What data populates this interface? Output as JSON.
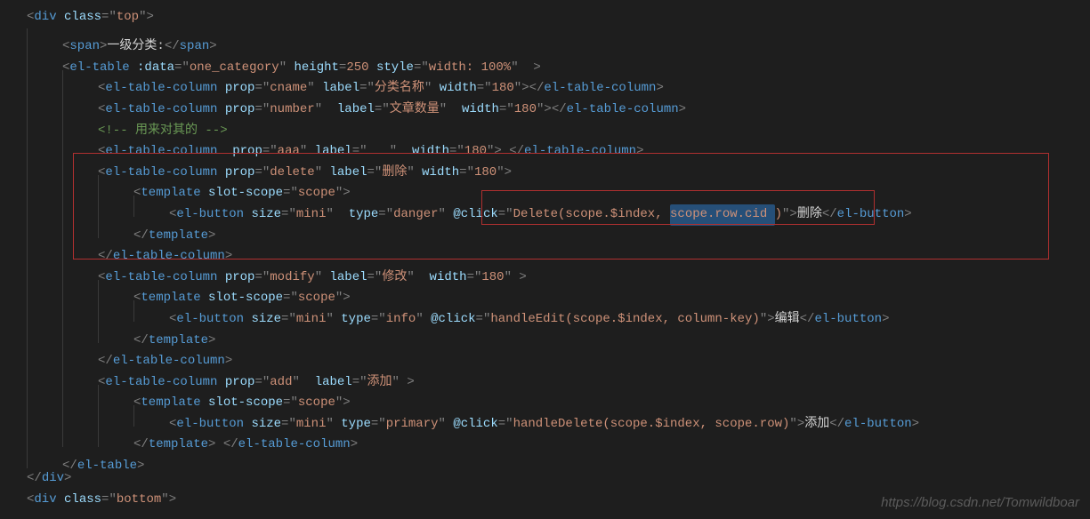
{
  "watermark": "https://blog.csdn.net/Tomwildboar",
  "tokens": {
    "lt": "<",
    "gt": ">",
    "lts": "</",
    "eq": "=",
    "q": "\"",
    "div": "div",
    "span": "span",
    "el_table": "el-table",
    "el_table_column": "el-table-column",
    "template": "template",
    "el_button": "el-button",
    "class": "class",
    "data_attr": ":data",
    "height_attr": "height",
    "style_attr": "style",
    "prop": "prop",
    "label": "label",
    "width_attr": "width",
    "slot_scope": "slot-scope",
    "size_attr": "size",
    "type_attr": "type",
    "click_attr": "@click"
  },
  "vals": {
    "top": "top",
    "bottom": "bottom",
    "one_cat": "one_category",
    "h250": "250",
    "w100": "width: 100%",
    "cname": "cname",
    "name_label": "分类名称",
    "w180": "180",
    "number": "number",
    "num_label": "文章数量",
    "comment1": "<!-- 用来对其的 -->",
    "aaa": "aaa",
    "blank_label": "   ",
    "delete": "delete",
    "del_label": "删除",
    "scope": "scope",
    "mini": "mini",
    "danger": "danger",
    "info": "info",
    "primary": "primary",
    "del_click": "Delete(scope.$index, ",
    "del_click_sel": "scope.row.cid ",
    "del_click_end": ")",
    "modify": "modify",
    "mod_label": "修改",
    "edit_click": "handleEdit(scope.$index, column-key)",
    "add": "add",
    "add_label": "添加",
    "add_click": "handleDelete(scope.$index, scope.row)",
    "span1": "一级分类:",
    "del_text": "删除",
    "edit_text": "编辑",
    "add_text": "添加"
  }
}
